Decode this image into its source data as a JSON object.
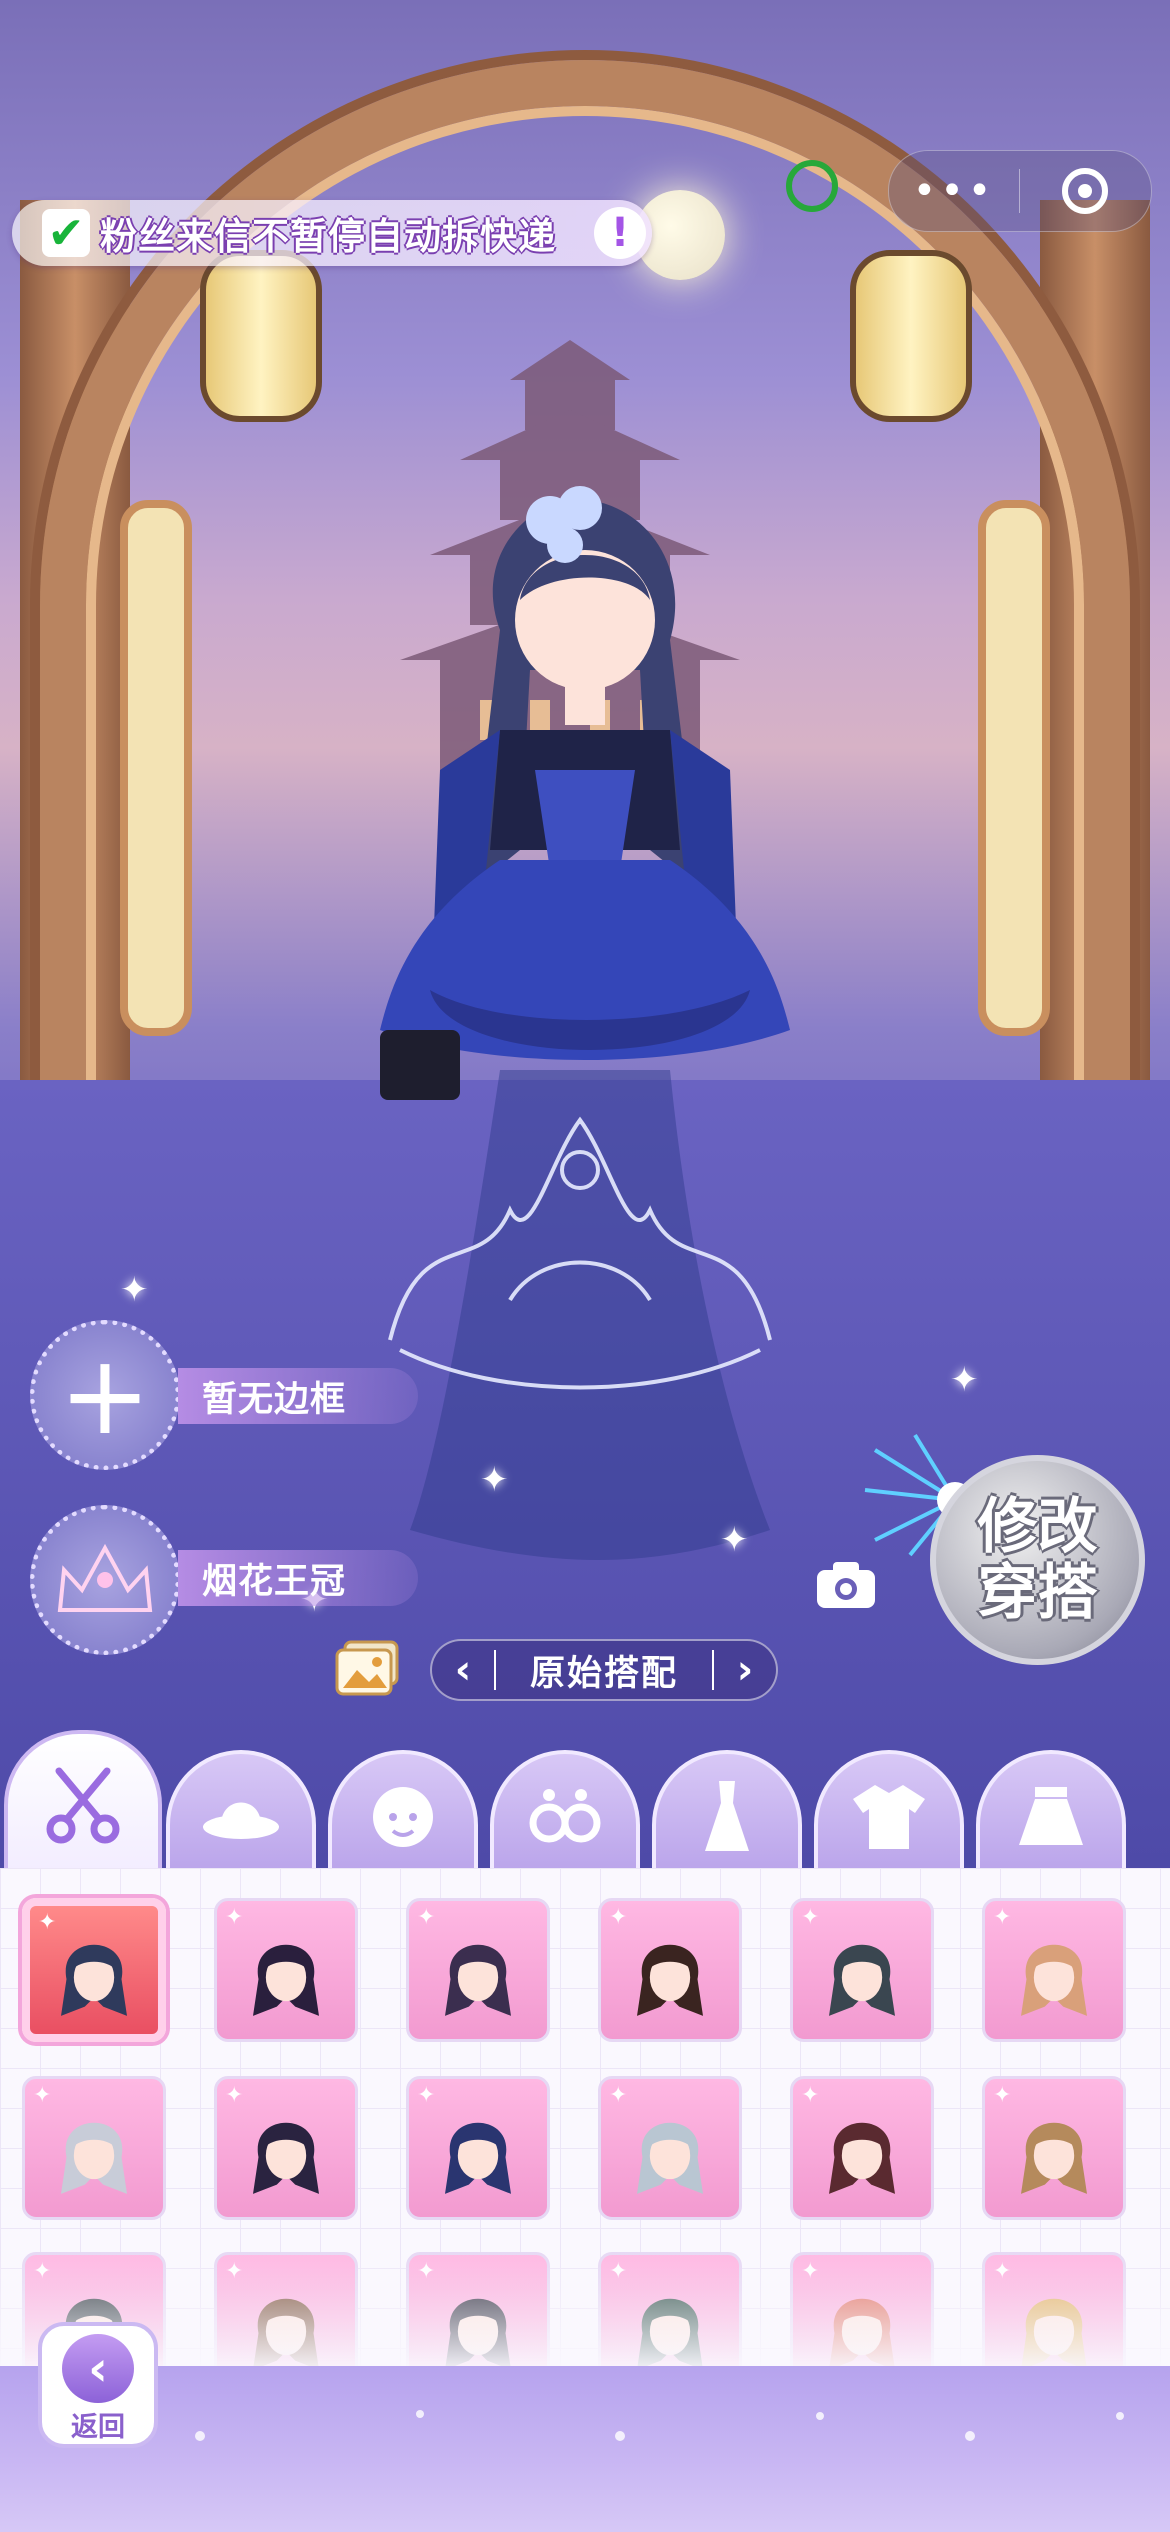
{
  "banner": {
    "checked": true,
    "text": "粉丝来信不暂停自动拆快递",
    "info_icon": "!"
  },
  "capsule": {
    "more_icon": "more-dots-icon",
    "close_icon": "target-circle-icon"
  },
  "slots": [
    {
      "label": "暂无边框",
      "icon": "plus-icon"
    },
    {
      "label": "烟花王冠",
      "icon": "crown-icon"
    }
  ],
  "modify_button": {
    "line1": "修改",
    "line2": "穿搭"
  },
  "outfit_nav": {
    "prev": "‹",
    "label": "原始搭配",
    "next": "›"
  },
  "tabs": [
    {
      "name": "hair",
      "icon": "scissors-icon",
      "active": true
    },
    {
      "name": "hat",
      "icon": "hat-icon",
      "active": false
    },
    {
      "name": "face",
      "icon": "face-icon",
      "active": false
    },
    {
      "name": "earrings",
      "icon": "earrings-icon",
      "active": false
    },
    {
      "name": "dress",
      "icon": "dress-icon",
      "active": false
    },
    {
      "name": "top",
      "icon": "shirt-icon",
      "active": false
    },
    {
      "name": "skirt",
      "icon": "skirt-icon",
      "active": false
    }
  ],
  "hair_items": [
    {
      "color": "#2f3a5c",
      "style": "long",
      "selected": true
    },
    {
      "color": "#2a1f3d",
      "style": "wavy-streak"
    },
    {
      "color": "#3b2e4f",
      "style": "buns"
    },
    {
      "color": "#3a2420",
      "style": "bob"
    },
    {
      "color": "#3a4650",
      "style": "short"
    },
    {
      "color": "#d9a07a",
      "style": "braids"
    },
    {
      "color": "#c8ccd8",
      "style": "twintails"
    },
    {
      "color": "#2a2340",
      "style": "long-wavy"
    },
    {
      "color": "#2a3570",
      "style": "red-tips"
    },
    {
      "color": "#b9c6d2",
      "style": "bob"
    },
    {
      "color": "#5a2a30",
      "style": "long"
    },
    {
      "color": "#b58a5c",
      "style": "long"
    },
    {
      "color": "#2f3a40",
      "style": "short"
    },
    {
      "color": "#7a5038",
      "style": "long"
    },
    {
      "color": "#2a2a3a",
      "style": "long"
    },
    {
      "color": "#2e5048",
      "style": "long"
    },
    {
      "color": "#e07060",
      "style": "long"
    },
    {
      "color": "#e0b060",
      "style": "long"
    }
  ],
  "back_button": {
    "label": "返回"
  },
  "colors": {
    "accent": "#a455e6",
    "panel_bg": "#faf8fe",
    "tab_bg": "#c8b5f0"
  }
}
